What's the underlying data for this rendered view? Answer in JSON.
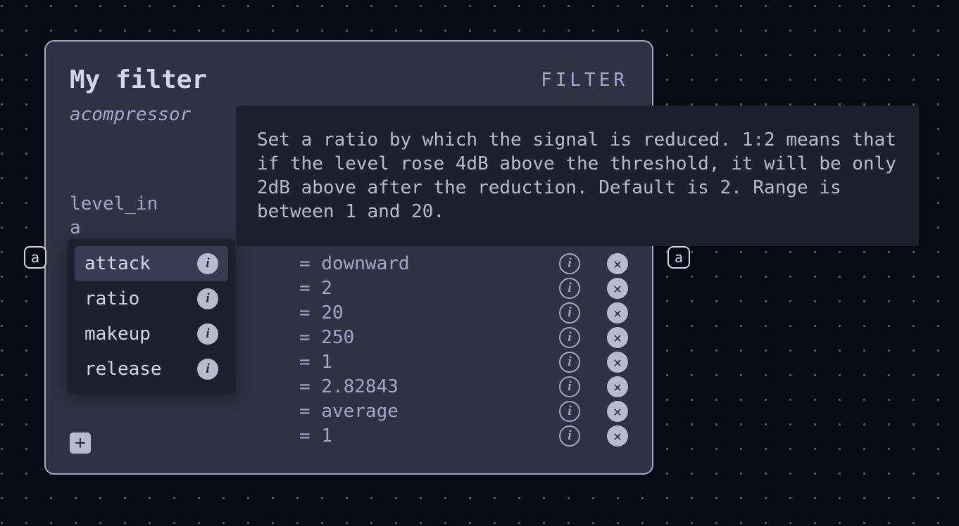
{
  "card": {
    "title": "My filter",
    "type_label": "FILTER",
    "subtitle": "acompressor"
  },
  "params": {
    "visible_label_1": "level_in",
    "visible_label_2": "a",
    "rows": [
      {
        "value": "= downward"
      },
      {
        "value": "= 2"
      },
      {
        "value": "= 20"
      },
      {
        "value": "= 250"
      },
      {
        "value": "= 1"
      },
      {
        "value": "= 2.82843"
      },
      {
        "value": "= average"
      },
      {
        "value": "= 1"
      }
    ]
  },
  "dropdown": {
    "items": [
      {
        "label": "attack",
        "selected": true
      },
      {
        "label": "ratio",
        "selected": false
      },
      {
        "label": "makeup",
        "selected": false
      },
      {
        "label": "release",
        "selected": false
      }
    ]
  },
  "tooltip": {
    "text": "Set a ratio by which the signal is reduced. 1:2 means that if the level rose 4dB above the threshold, it will be only 2dB above after the reduction. Default is 2. Range is between 1 and 20."
  },
  "handle_label": "a",
  "add_label": "+",
  "info_glyph": "i",
  "close_glyph": "✕"
}
